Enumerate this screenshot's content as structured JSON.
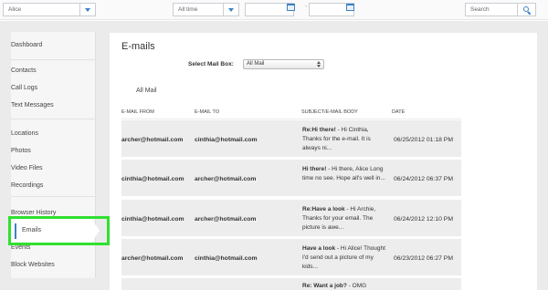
{
  "topbar": {
    "device_value": "Alice",
    "period_value": "All time",
    "date_separator": "-",
    "search_placeholder": "Search"
  },
  "sidebar": {
    "items": [
      {
        "label": "Dashboard"
      },
      {
        "label": "Contacts"
      },
      {
        "label": "Call Logs"
      },
      {
        "label": "Text Messages"
      },
      {
        "label": "Locations"
      },
      {
        "label": "Photos"
      },
      {
        "label": "Video Files"
      },
      {
        "label": "Recordings"
      },
      {
        "label": "Browser History"
      },
      {
        "label": "Emails"
      },
      {
        "label": "Events"
      },
      {
        "label": "Block Websites"
      }
    ],
    "active_item": "Emails"
  },
  "main": {
    "title": "E-mails",
    "mailbox_label": "Select Mail Box:",
    "mailbox_value": "All Mail",
    "tab_label": "All Mail",
    "columns": [
      "E-MAIL FROM",
      "E-MAIL TO",
      "SUBJECT/E-MAIL BODY",
      "DATE"
    ],
    "rows": [
      {
        "from": "archer@hotmail.com",
        "to": "cinthia@hotmail.com",
        "subject": "Re:Hi there!",
        "body": "- Hi Cinthia, Thanks for the e-mail.    It is always ni...",
        "date": "06/25/2012 01:18 PM"
      },
      {
        "from": "cinthia@hotmail.com",
        "to": "archer@hotmail.com",
        "subject": "Hi there!",
        "body": "- Hi there, Alice Long time no see. Hope all's well in...",
        "date": "06/24/2012 06:37 PM"
      },
      {
        "from": "cinthia@hotmail.com",
        "to": "archer@hotmail.com",
        "subject": "Re:Have a look",
        "body": "- Hi Archie, Thanks for your email. The picture is awe...",
        "date": "06/24/2012 12:10 PM"
      },
      {
        "from": "archer@hotmail.com",
        "to": "cinthia@hotmail.com",
        "subject": "Have a look",
        "body": "- Hi Alice! Thought I'd send out a picture of my kids...",
        "date": "06/23/2012 06:27 PM"
      },
      {
        "from": "",
        "to": "",
        "subject": "Re: Want a job?",
        "body": "- OMG",
        "date": ""
      }
    ]
  },
  "colors": {
    "accent": "#3d82c4",
    "highlight": "#2fe02f"
  }
}
